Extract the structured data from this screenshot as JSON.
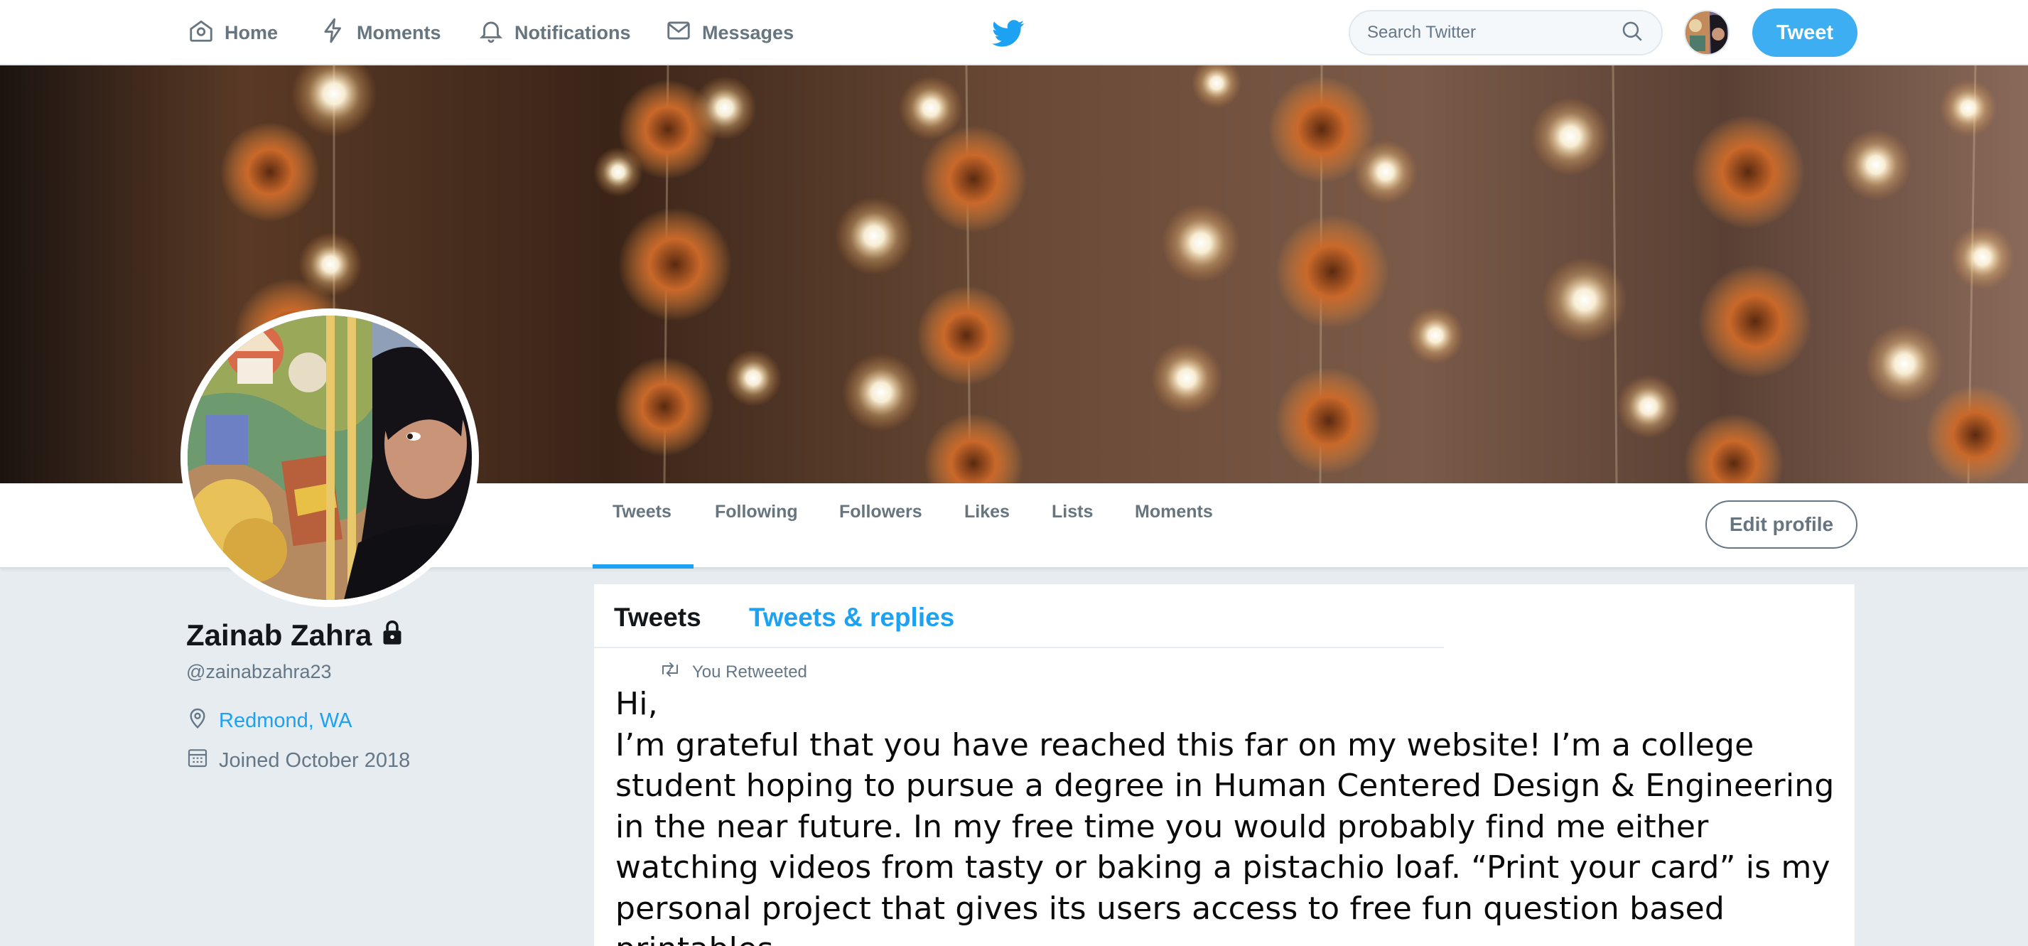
{
  "nav": {
    "items": [
      {
        "label": "Home",
        "icon": "home-icon"
      },
      {
        "label": "Moments",
        "icon": "lightning-icon"
      },
      {
        "label": "Notifications",
        "icon": "bell-icon"
      },
      {
        "label": "Messages",
        "icon": "envelope-icon"
      }
    ],
    "logo_icon": "twitter-bird-icon",
    "search_placeholder": "Search Twitter",
    "tweet_button": "Tweet"
  },
  "profile_nav": {
    "tabs": [
      {
        "label": "Tweets"
      },
      {
        "label": "Following"
      },
      {
        "label": "Followers"
      },
      {
        "label": "Likes"
      },
      {
        "label": "Lists"
      },
      {
        "label": "Moments"
      }
    ],
    "edit_profile": "Edit profile"
  },
  "profile": {
    "name": "Zainab Zahra",
    "handle": "@zainabzahra23",
    "location": "Redmond, WA",
    "joined": "Joined October 2018",
    "protected_icon": "lock-icon"
  },
  "timeline": {
    "tabs": [
      "Tweets",
      "Tweets & replies"
    ],
    "retweet_label": "You Retweeted",
    "tweet_lines": [
      "Hi,",
      "I’m grateful that you have reached this far on my website! I’m a college student hoping to pursue a degree in Human Centered Design & Engineering in the near future. In my free time you would probably find me either watching videos from tasty or baking a pistachio loaf. “Print your card” is my personal project that gives its users access to free fun question based printables."
    ]
  },
  "colors": {
    "accent": "#1da1f2",
    "muted": "#657786",
    "background": "#e6ecf0"
  }
}
